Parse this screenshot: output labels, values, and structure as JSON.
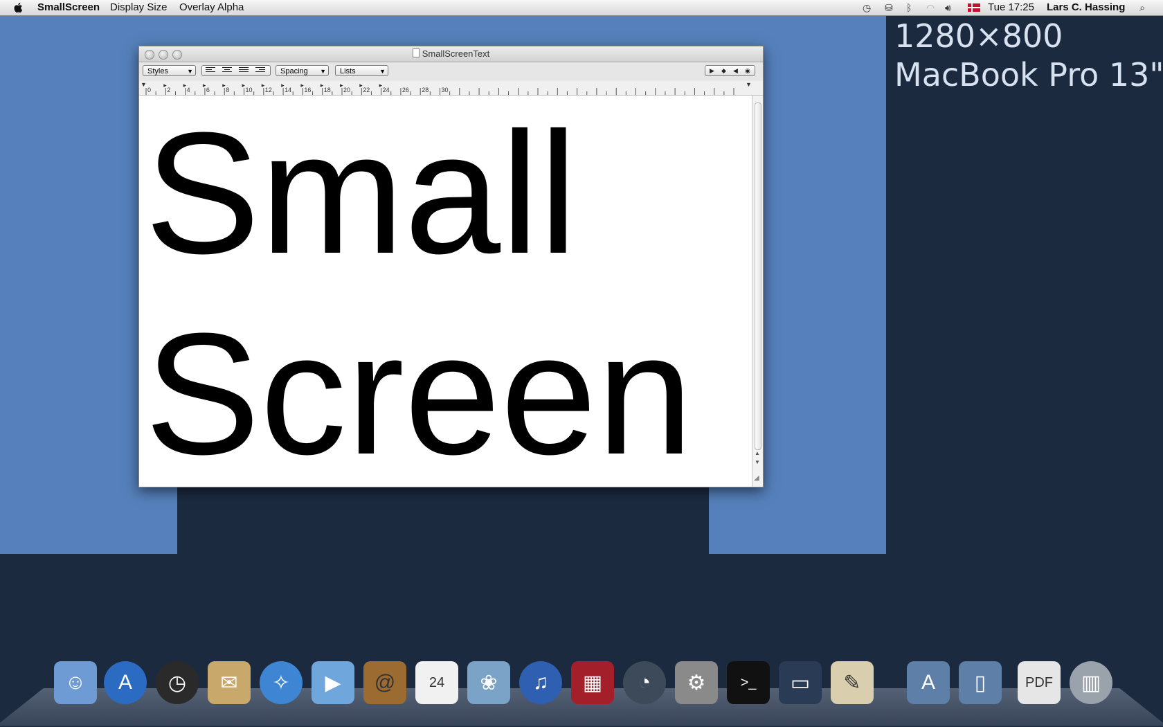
{
  "menubar": {
    "app_name": "SmallScreen",
    "menus": [
      "Display Size",
      "Overlay Alpha"
    ],
    "clock": "Tue 17:25",
    "user": "Lars C. Hassing",
    "status_icons": [
      "time-machine-icon",
      "binoculars-icon",
      "bluetooth-icon",
      "wifi-icon",
      "volume-icon",
      "flag-icon",
      "spotlight-icon"
    ]
  },
  "overlay": {
    "resolution": "1280×800",
    "model": "MacBook Pro 13\""
  },
  "window": {
    "title": "SmallScreenText",
    "toolbar": {
      "styles": "Styles",
      "spacing": "Spacing",
      "lists": "Lists"
    },
    "ruler_numbers": [
      "0",
      "2",
      "4",
      "6",
      "8",
      "10",
      "12",
      "14",
      "16",
      "18",
      "20",
      "22",
      "24",
      "26",
      "28",
      "30"
    ],
    "content_lines": [
      "Small",
      "Screen"
    ]
  },
  "dock": {
    "items": [
      {
        "name": "finder-icon",
        "glyph": "☺",
        "color": "#6f9bd4"
      },
      {
        "name": "app-store-icon",
        "glyph": "A",
        "color": "#2b6cc2"
      },
      {
        "name": "dashboard-icon",
        "glyph": "◷",
        "color": "#2a2a2a"
      },
      {
        "name": "mail-icon",
        "glyph": "✉",
        "color": "#c9a86b"
      },
      {
        "name": "safari-icon",
        "glyph": "✧",
        "color": "#3e86d3"
      },
      {
        "name": "facetime-icon",
        "glyph": "▶",
        "color": "#6fa6dc"
      },
      {
        "name": "address-book-icon",
        "glyph": "@",
        "color": "#9b6b32"
      },
      {
        "name": "calendar-icon",
        "glyph": "24",
        "color": "#f1f1f1"
      },
      {
        "name": "iphoto-icon",
        "glyph": "❀",
        "color": "#7aa3c7"
      },
      {
        "name": "itunes-icon",
        "glyph": "♫",
        "color": "#2e5fb0"
      },
      {
        "name": "photo-booth-icon",
        "glyph": "▦",
        "color": "#a3202a"
      },
      {
        "name": "time-machine-icon",
        "glyph": "◔",
        "color": "#3c4a5a"
      },
      {
        "name": "system-preferences-icon",
        "glyph": "⚙",
        "color": "#8a8a8a"
      },
      {
        "name": "terminal-icon",
        "glyph": ">_",
        "color": "#111111"
      },
      {
        "name": "smallscreen-icon",
        "glyph": "▭",
        "color": "#2a3b55"
      },
      {
        "name": "textedit-icon",
        "glyph": "✎",
        "color": "#d9cfae"
      },
      {
        "name": "applications-folder-icon",
        "glyph": "A",
        "color": "#5d7fa8"
      },
      {
        "name": "documents-folder-icon",
        "glyph": "▯",
        "color": "#5d7fa8"
      },
      {
        "name": "pdf-document-icon",
        "glyph": "PDF",
        "color": "#e6e6e6"
      },
      {
        "name": "trash-icon",
        "glyph": "▥",
        "color": "#9aa2ab"
      }
    ]
  }
}
